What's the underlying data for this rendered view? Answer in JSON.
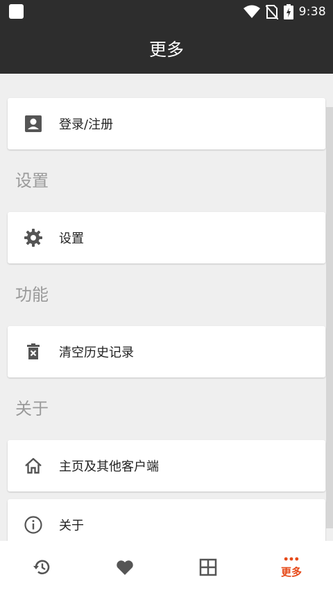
{
  "status_bar": {
    "time": "9:38"
  },
  "app_bar": {
    "title": "更多"
  },
  "account": {
    "login_label": "登录/注册"
  },
  "sections": {
    "settings_header": "设置",
    "function_header": "功能",
    "about_header": "关于"
  },
  "items": {
    "settings_label": "设置",
    "clear_history_label": "清空历史记录",
    "homepage_label": "主页及其他客户端",
    "about_label": "关于"
  },
  "bottom_nav": {
    "more_label": "更多",
    "active_color": "#e64a19",
    "icons": [
      "history-icon",
      "heart-icon",
      "grid-icon",
      "more-icon"
    ]
  }
}
